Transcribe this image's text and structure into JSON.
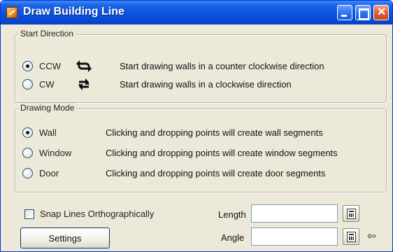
{
  "window": {
    "title": "Draw Building Line"
  },
  "start_direction": {
    "legend": "Start Direction",
    "options": [
      {
        "label": "CCW",
        "description": "Start drawing walls in a counter clockwise direction",
        "selected": true,
        "icon": "rotate-ccw-icon"
      },
      {
        "label": "CW",
        "description": "Start drawing walls in a clockwise direction",
        "selected": false,
        "icon": "rotate-cw-icon"
      }
    ]
  },
  "drawing_mode": {
    "legend": "Drawing Mode",
    "options": [
      {
        "label": "Wall",
        "description": "Clicking and dropping points will create wall segments",
        "selected": true
      },
      {
        "label": "Window",
        "description": "Clicking and dropping points will create window segments",
        "selected": false
      },
      {
        "label": "Door",
        "description": "Clicking and dropping points will create door segments",
        "selected": false
      }
    ]
  },
  "snap": {
    "label": "Snap Lines Orthographically",
    "checked": false
  },
  "length": {
    "label": "Length",
    "value": ""
  },
  "angle": {
    "label": "Angle",
    "value": ""
  },
  "settings_button": {
    "label": "Settings"
  },
  "colors": {
    "titlebar": "#0a54e0",
    "dialog_bg": "#ece9d8"
  }
}
